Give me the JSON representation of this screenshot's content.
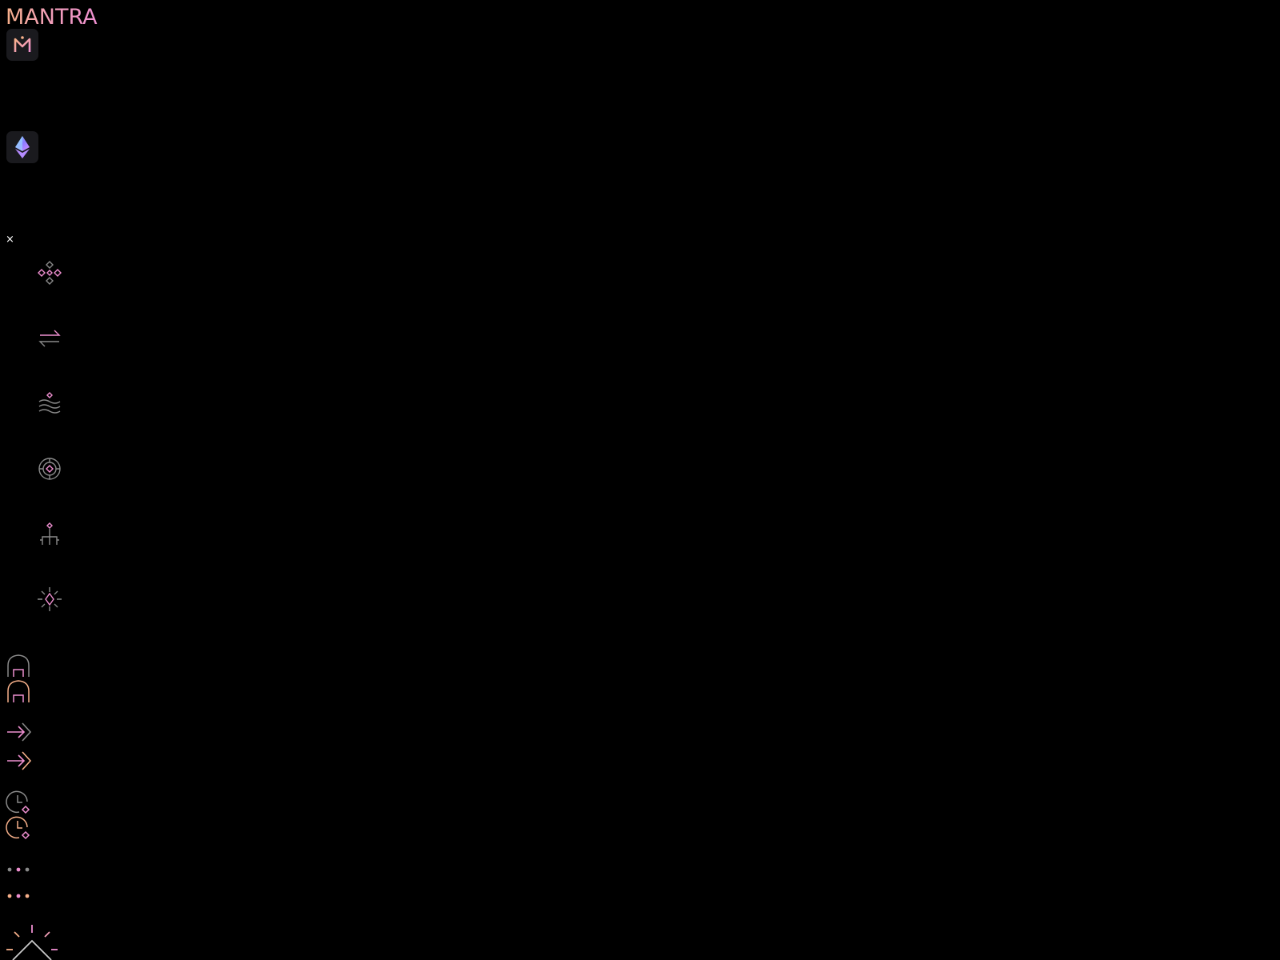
{
  "brand": {
    "logo_text": "MANTRA"
  },
  "icons": {
    "app_tile": "mantra-m-icon",
    "network_tile": "ethereum-icon",
    "close": "close-icon",
    "nav": [
      "dashboard-diamonds-icon",
      "swap-arrows-icon",
      "pool-waves-icon",
      "stake-compass-icon",
      "hierarchy-icon",
      "sparkle-star-icon"
    ],
    "footer": [
      "home-icon",
      "home-icon",
      "arrow-right-icon",
      "arrow-right-icon",
      "clock-diamond-icon",
      "clock-diamond-icon",
      "more-dots-icon",
      "more-dots-icon",
      "sunrise-icon"
    ]
  },
  "close_label": "×",
  "colors": {
    "background": "#000000",
    "tile": "#1a1a1e",
    "pink": "#ee8fd0",
    "peach": "#f7b08a",
    "grey": "#8a8a8a"
  }
}
